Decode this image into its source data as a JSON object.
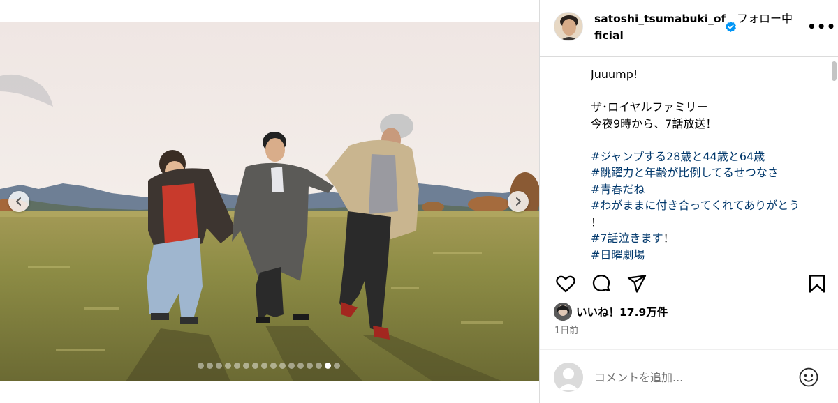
{
  "post": {
    "carousel": {
      "slide_count": 16,
      "active_index": 14
    }
  },
  "header": {
    "username": "satoshi_tsumabuki_official",
    "follow_status": "フォロー中",
    "more_icon": "ellipsis-icon"
  },
  "caption": {
    "lines": [
      {
        "text": "Juuump!",
        "type": "text"
      },
      {
        "text": "",
        "type": "gap"
      },
      {
        "text": "ザ･ロイヤルファミリー",
        "type": "text"
      },
      {
        "text": "今夜9時から、7話放送！",
        "type": "text"
      },
      {
        "text": "",
        "type": "gap"
      },
      {
        "text": "#ジャンプする28歳と44歳と64歳",
        "type": "tag"
      },
      {
        "text": "#跳躍力と年齢が比例してるせつなさ",
        "type": "tag"
      },
      {
        "text": "#青春だね",
        "type": "tag"
      },
      {
        "text": "#わがままに付き合ってくれてありがとう",
        "type": "tag"
      },
      {
        "text": "！",
        "type": "text"
      },
      {
        "text": "#7話泣きます",
        "type": "tag",
        "suffix": "！"
      },
      {
        "text": "#日曜劇場",
        "type": "tag"
      }
    ]
  },
  "actions": {
    "like_icon": "heart-icon",
    "comment_icon": "comment-icon",
    "share_icon": "share-icon",
    "save_icon": "bookmark-icon"
  },
  "likes": {
    "text": "いいね！17.9万件"
  },
  "timestamp": "1日前",
  "comment": {
    "placeholder": "コメントを追加...",
    "emoji_icon": "smiley-icon"
  },
  "colors": {
    "hashtag": "#00376b",
    "verified": "#0095f6",
    "divider": "#dbdbdb",
    "muted": "#737373"
  }
}
